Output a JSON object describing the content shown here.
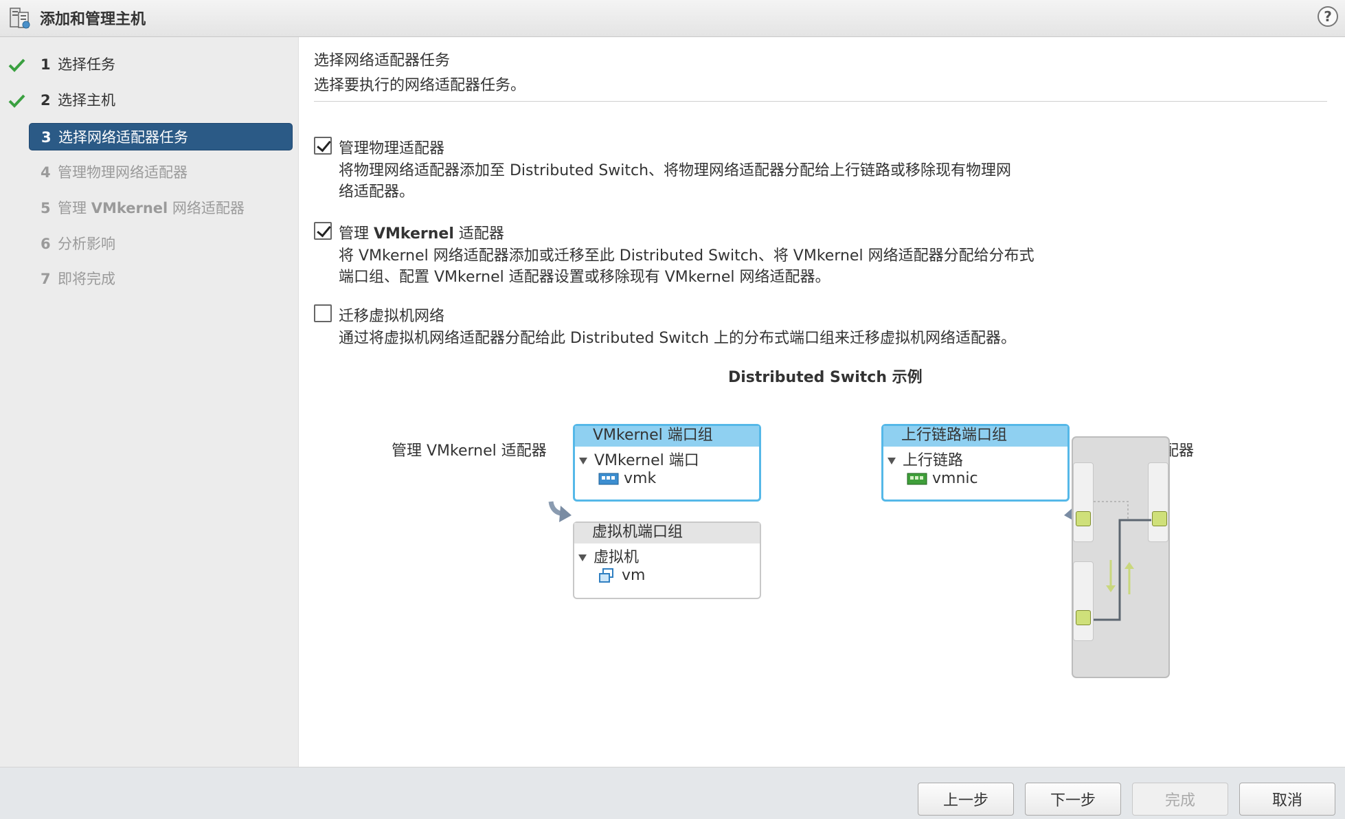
{
  "window": {
    "title": "添加和管理主机",
    "help_symbol": "?"
  },
  "steps": [
    {
      "num": "1",
      "label": "选择任务",
      "state": "done"
    },
    {
      "num": "2",
      "label": "选择主机",
      "state": "done"
    },
    {
      "num": "3",
      "label": "选择网络适配器任务",
      "state": "active"
    },
    {
      "num": "4",
      "label": "管理物理网络适配器",
      "state": "pending"
    },
    {
      "num": "5",
      "label_prefix": "管理 ",
      "label_bold": "VMkernel",
      "label_suffix": " 网络适配器",
      "state": "pending"
    },
    {
      "num": "6",
      "label": "分析影响",
      "state": "pending"
    },
    {
      "num": "7",
      "label": "即将完成",
      "state": "pending"
    }
  ],
  "main": {
    "title": "选择网络适配器任务",
    "subtitle": "选择要执行的网络适配器任务。",
    "options": [
      {
        "label": "管理物理适配器",
        "checked": true,
        "desc_line1": "将物理网络适配器添加至 Distributed Switch、将物理网络适配器分配给上行链路或移除现有物理网",
        "desc_line2": "络适配器。"
      },
      {
        "label_prefix": "管理 ",
        "label_bold": "VMkernel",
        "label_suffix": " 适配器",
        "checked": true,
        "desc_line1": "将 VMkernel 网络适配器添加或迁移至此 Distributed Switch、将 VMkernel 网络适配器分配给分布式",
        "desc_line2": "端口组、配置 VMkernel 适配器设置或移除现有 VMkernel 网络适配器。"
      },
      {
        "label": "迁移虚拟机网络",
        "checked": false,
        "desc_line1": "通过将虚拟机网络适配器分配给此 Distributed Switch 上的分布式端口组来迁移虚拟机网络适配器。"
      }
    ]
  },
  "diagram": {
    "title": "Distributed Switch 示例",
    "left_label": "管理 VMkernel 适配器",
    "right_label": "管理物理适配器",
    "vmkernel_group": {
      "header": "VMkernel 端口组",
      "row": "VMkernel 端口",
      "item": "vmk"
    },
    "vm_group": {
      "header": "虚拟机端口组",
      "row": "虚拟机",
      "item": "vm"
    },
    "uplink_group": {
      "header": "上行链路端口组",
      "row": "上行链路",
      "item": "vmnic"
    },
    "colors": {
      "group_border": "#55b8e8",
      "group_header": "#8fd0f1",
      "port": "#cfe07a",
      "active_step": "#2b5a86",
      "check": "#3aa040"
    }
  },
  "footer": {
    "back": "上一步",
    "next": "下一步",
    "finish": "完成",
    "cancel": "取消"
  }
}
